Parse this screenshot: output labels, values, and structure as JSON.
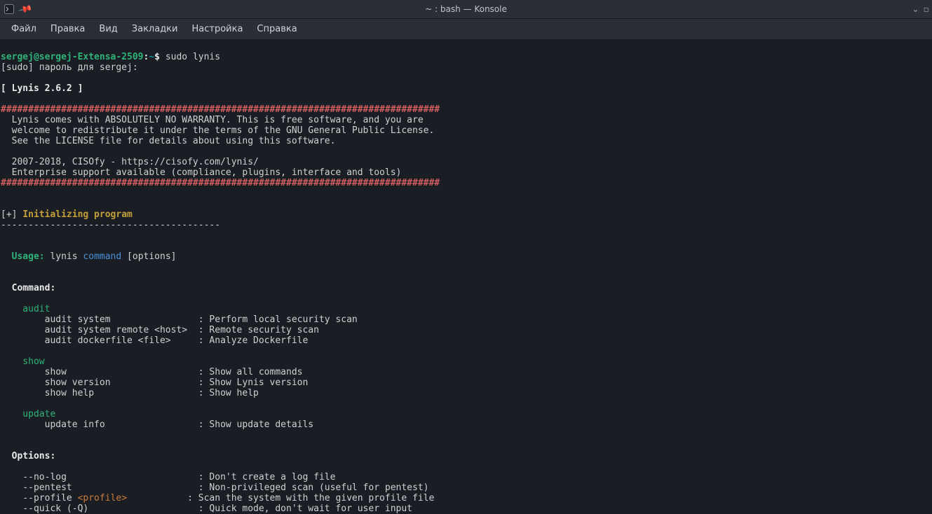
{
  "window": {
    "title": "~ : bash — Konsole"
  },
  "menu": {
    "file": "Файл",
    "edit": "Правка",
    "view": "Вид",
    "bookmarks": "Закладки",
    "settings": "Настройка",
    "help": "Справка"
  },
  "prompt": {
    "userhost": "sergej@sergej-Extensa-2509",
    "sep": ":",
    "path": "~",
    "dollar": "$ ",
    "command": "sudo lynis"
  },
  "sudo_prompt": "[sudo] пароль для sergej:",
  "banner": {
    "version_line": "[ Lynis 2.6.2 ]",
    "hash": "################################################################################",
    "l1": "  Lynis comes with ABSOLUTELY NO WARRANTY. This is free software, and you are",
    "l2": "  welcome to redistribute it under the terms of the GNU General Public License.",
    "l3": "  See the LICENSE file for details about using this software.",
    "l4": "  2007-2018, CISOfy - https://cisofy.com/lynis/",
    "l5": "  Enterprise support available (compliance, plugins, interface and tools)"
  },
  "init": {
    "bracket_open": "[+] ",
    "text": "Initializing program",
    "dashes": "----------------------------------------"
  },
  "usage": {
    "label": "Usage:",
    "text": " lynis ",
    "command": "command",
    "options": " [options]"
  },
  "cmdhdr": "  Command:",
  "audit": {
    "title": "    audit",
    "l1": "        audit system                : Perform local security scan",
    "l2": "        audit system remote <host>  : Remote security scan",
    "l3": "        audit dockerfile <file>     : Analyze Dockerfile"
  },
  "show": {
    "title": "    show",
    "l1": "        show                        : Show all commands",
    "l2": "        show version                : Show Lynis version",
    "l3": "        show help                   : Show help"
  },
  "update": {
    "title": "    update",
    "l1": "        update info                 : Show update details"
  },
  "opthdr": "  Options:",
  "options": {
    "l1": "    --no-log                        : Don't create a log file",
    "l2": "    --pentest                       : Non-privileged scan (useful for pentest)",
    "l3a": "    --profile ",
    "l3_arg": "<profile>",
    "l3b": "           : Scan the system with the given profile file",
    "l4": "    --quick (-Q)                    : Quick mode, don't wait for user input"
  }
}
